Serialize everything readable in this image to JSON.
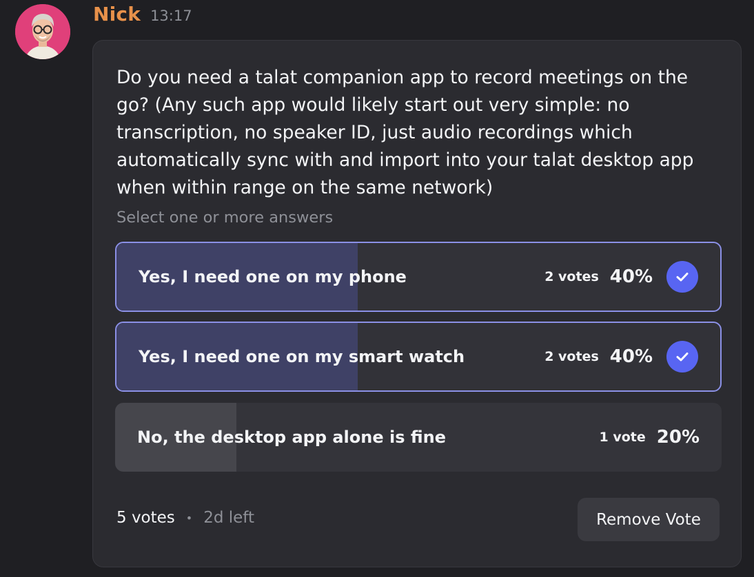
{
  "message": {
    "author": "Nick",
    "timestamp": "13:17",
    "author_color": "#e8914a",
    "avatar_icon": "user-avatar-photo"
  },
  "poll": {
    "question": "Do you need a talat companion app to record meetings on the go? (Any such app would likely start out very simple: no transcription, no speaker ID, just audio recordings which automatically sync with and import into your talat desktop app when within range on the same network)",
    "hint": "Select one or more answers",
    "answers": [
      {
        "label": "Yes, I need one on my phone",
        "votes": "2 votes",
        "percent": "40%",
        "fraction": 0.4,
        "selected": true
      },
      {
        "label": "Yes, I need one on my smart watch",
        "votes": "2 votes",
        "percent": "40%",
        "fraction": 0.4,
        "selected": true
      },
      {
        "label": "No, the desktop app alone is fine",
        "votes": "1 vote",
        "percent": "20%",
        "fraction": 0.2,
        "selected": false
      }
    ],
    "total_votes": "5 votes",
    "separator": "•",
    "time_left": "2d left",
    "remove_vote_label": "Remove Vote"
  },
  "colors": {
    "accent": "#5865f2",
    "selected_border": "#8b90e6",
    "background": "#1f1f23",
    "card": "#2b2b30"
  }
}
